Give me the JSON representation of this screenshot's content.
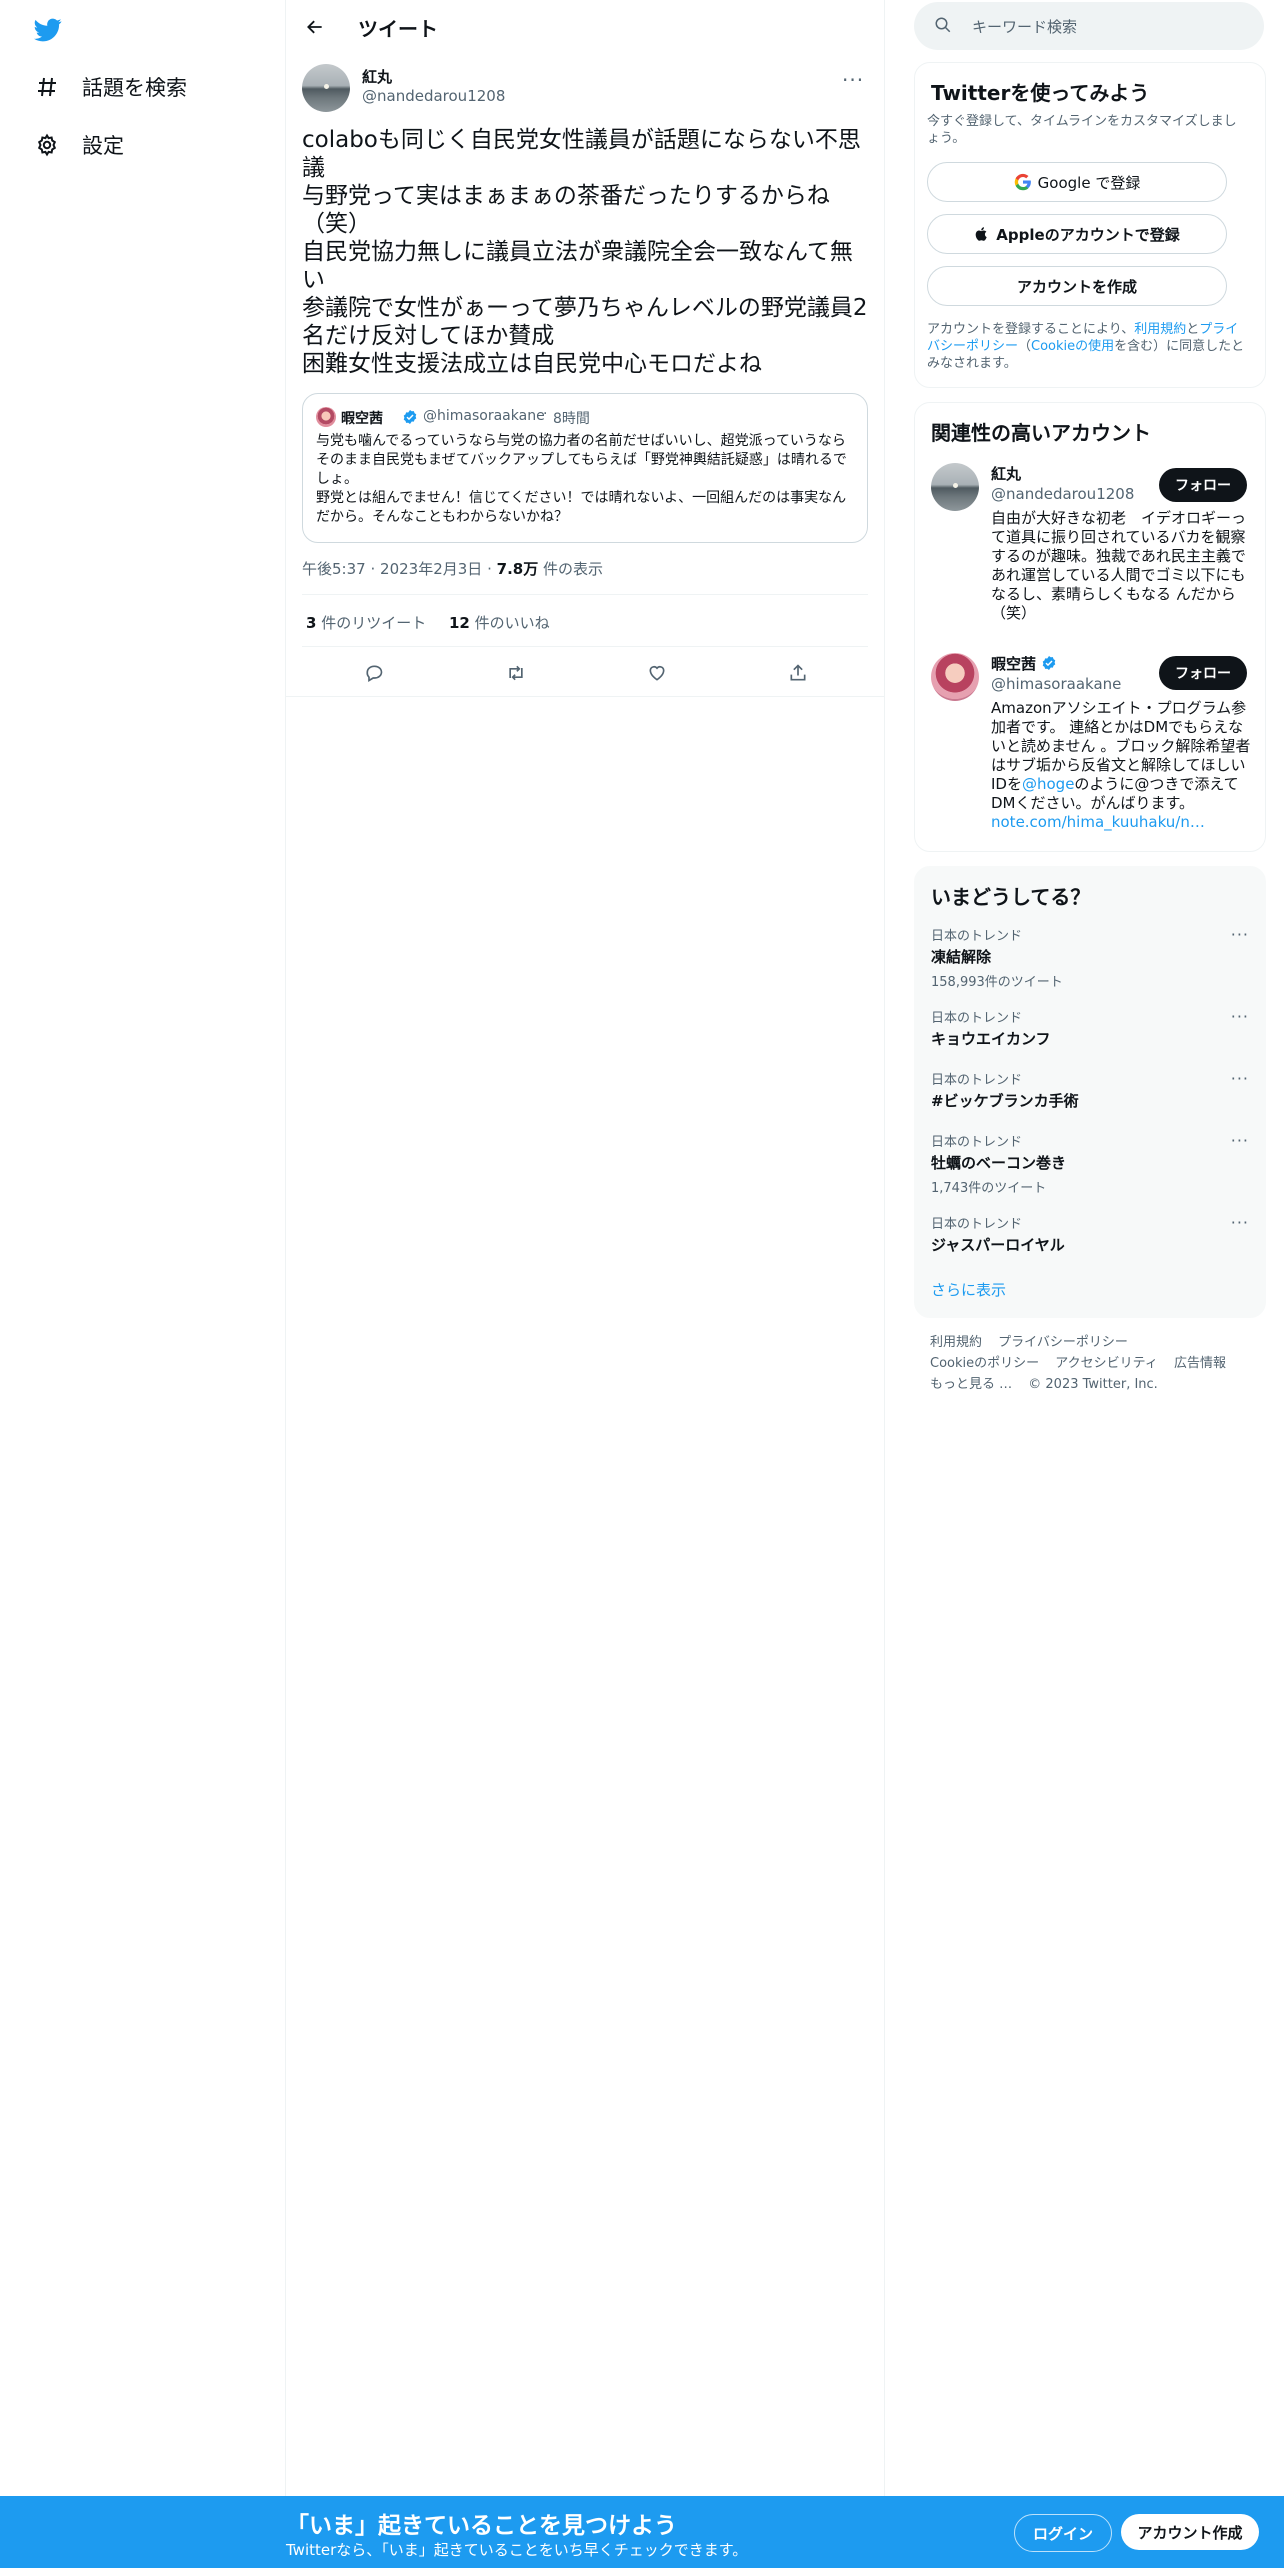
{
  "colors": {
    "accent": "#1d9bf0",
    "text": "#0f1419",
    "muted": "#536471",
    "border": "#eff3f4"
  },
  "sidebar": {
    "logo_icon": "twitter-bird-icon",
    "items": [
      {
        "icon": "hashtag-icon",
        "label": "話題を検索"
      },
      {
        "icon": "gear-icon",
        "label": "設定"
      }
    ]
  },
  "header": {
    "back_icon": "arrow-left-icon",
    "title": "ツイート"
  },
  "tweet": {
    "author_name": "紅丸",
    "author_handle": "@nandedarou1208",
    "more_label": "···",
    "text": "colaboも同じく自民党女性議員が話題にならない不思議\n与野党って実はまぁまぁの茶番だったりするからね（笑）\n自民党協力無しに議員立法が衆議院全会一致なんて無い\n参議院で女性がぁーって夢乃ちゃんレベルの野党議員2名だけ反対してほか賛成\n困難女性支援法成立は自民党中心モロだよね",
    "quote": {
      "name": "暇空茜",
      "handle": "@himasoraakane",
      "dot": "·",
      "time": "8時間",
      "text": "与党も噛んでるっていうなら与党の協力者の名前だせばいいし、超党派っていうならそのまま自民党もまぜてバックアップしてもらえば「野党神輿結託疑惑」は晴れるでしょ。\n野党とは組んでません！信じてください！では晴れないよ、一回組んだのは事実なんだから。そんなこともわからないかね？"
    },
    "time": "午後5:37",
    "date": "2023年2月3日",
    "sep": "·",
    "views": "7.8万",
    "views_label": " 件の表示",
    "retweets": "3",
    "retweets_label": " 件のリツイート",
    "likes": "12",
    "likes_label": " 件のいいね"
  },
  "search": {
    "placeholder": "キーワード検索"
  },
  "signup_card": {
    "title": "Twitterを使ってみよう",
    "subtitle": "今すぐ登録して、タイムラインをカスタマイズしましょう。",
    "google_label": "Google で登録",
    "apple_label": "Appleのアカウントで登録",
    "create_label": "アカウントを作成",
    "legal_prefix": "アカウントを登録することにより、",
    "legal_terms": "利用規約",
    "legal_and": "と",
    "legal_privacy": "プライバシーポリシー",
    "legal_open": "（",
    "legal_cookie": "Cookieの使用",
    "legal_suffix": "を含む）に同意したとみなされます。"
  },
  "related": {
    "title": "関連性の高いアカウント",
    "follow_label": "フォロー",
    "accounts": [
      {
        "name": "紅丸",
        "handle": "@nandedarou1208",
        "bio": "自由が大好きな初老　イデオロギーって道具に振り回されているバカを観察するのが趣味。独裁であれ民主主義であれ運営している人間でゴミ以下にもなるし、素晴らしくもなる んだから（笑）"
      },
      {
        "name": "暇空茜",
        "handle": "@himasoraakane",
        "bio_pre": "Amazonアソシエイト・プログラム参加者です。 連絡とかはDMでもらえないと読めません 。ブロック解除希望者はサブ垢から反省文と解除してほしいIDを",
        "bio_mention": "@hoge",
        "bio_mid": "のように@つきで添えてDMください。がんばります。",
        "bio_link": "note.com/hima_kuuhaku/n…"
      }
    ]
  },
  "trends": {
    "title": "いまどうしてる？",
    "more_icon": "···",
    "items": [
      {
        "category": "日本のトレンド",
        "topic": "凍結解除",
        "count": "158,993件のツイート"
      },
      {
        "category": "日本のトレンド",
        "topic": "キョウエイカンフ",
        "count": ""
      },
      {
        "category": "日本のトレンド",
        "topic": "#ビッケブランカ手術",
        "count": ""
      },
      {
        "category": "日本のトレンド",
        "topic": "牡蠣のベーコン巻き",
        "count": "1,743件のツイート"
      },
      {
        "category": "日本のトレンド",
        "topic": "ジャスパーロイヤル",
        "count": ""
      }
    ],
    "show_more": "さらに表示"
  },
  "footer": {
    "links_row1": [
      "利用規約",
      "プライバシーポリシー"
    ],
    "links_row2": [
      "Cookieのポリシー",
      "アクセシビリティ",
      "広告情報"
    ],
    "more": "もっと見る …",
    "copyright": "© 2023 Twitter, Inc."
  },
  "banner": {
    "title": "「いま」起きていることを見つけよう",
    "subtitle": "Twitterなら、「いま」起きていることをいち早くチェックできます。",
    "login_label": "ログイン",
    "signup_label": "アカウント作成"
  }
}
